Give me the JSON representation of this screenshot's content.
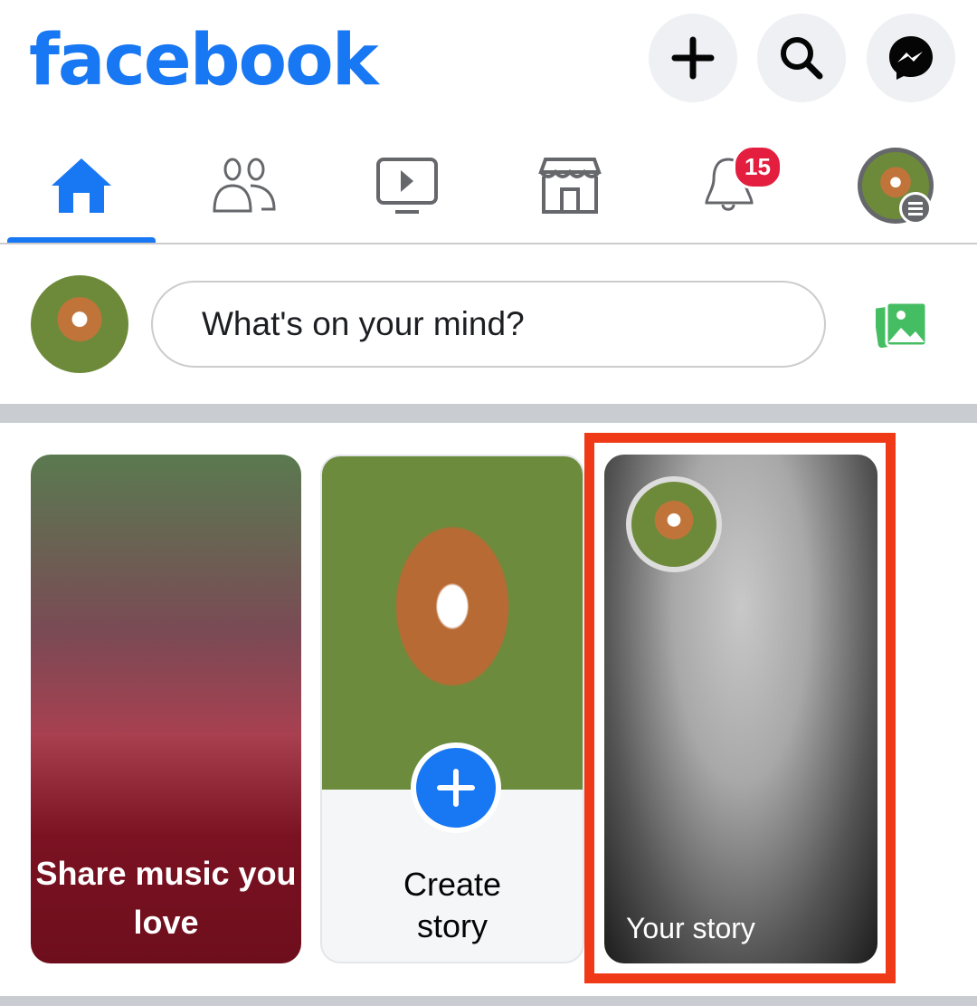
{
  "header": {
    "logo": "facebook",
    "buttons": [
      {
        "icon": "plus-icon"
      },
      {
        "icon": "search-icon"
      },
      {
        "icon": "messenger-icon"
      }
    ]
  },
  "nav": {
    "tabs": [
      {
        "icon": "home-icon",
        "active": true
      },
      {
        "icon": "friends-icon"
      },
      {
        "icon": "watch-icon"
      },
      {
        "icon": "marketplace-icon"
      },
      {
        "icon": "bell-icon",
        "badge": "15"
      },
      {
        "icon": "profile-menu-icon"
      }
    ]
  },
  "composer": {
    "placeholder": "What's on your mind?",
    "photo_icon": "photo-icon"
  },
  "stories": [
    {
      "label": "Share music you love"
    },
    {
      "label": "Create story"
    },
    {
      "label": "Your story",
      "highlighted": true
    }
  ],
  "colors": {
    "brand": "#1877F2",
    "badge": "#E41E3F",
    "highlight": "#F03A17",
    "photo": "#45BD62"
  }
}
